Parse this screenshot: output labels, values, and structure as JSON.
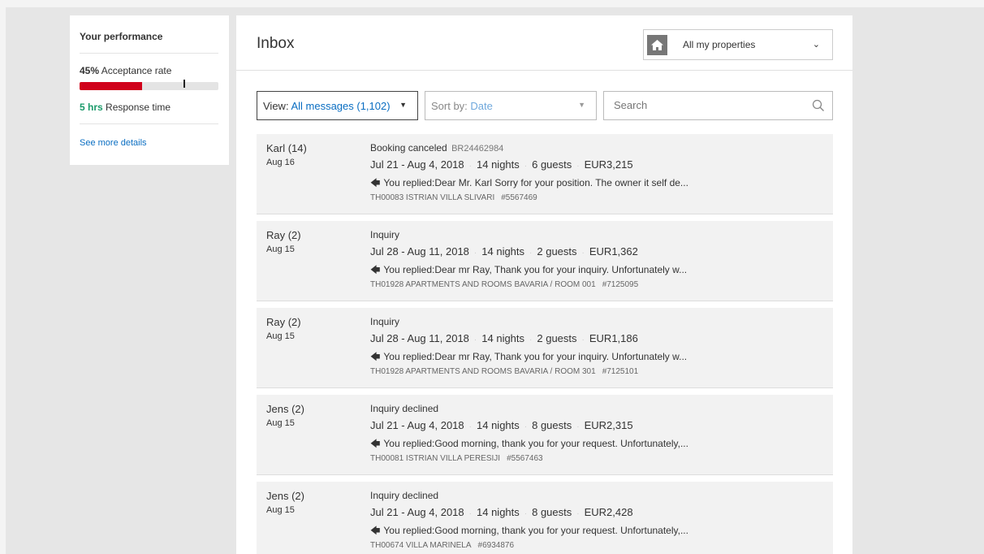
{
  "performance": {
    "title": "Your performance",
    "acceptance_value": "45%",
    "acceptance_label": "Acceptance rate",
    "acceptance_fraction": 0.45,
    "response_value": "5 hrs",
    "response_label": "Response time",
    "see_more": "See more details"
  },
  "inbox": {
    "title": "Inbox",
    "property_selector": "All my properties"
  },
  "filters": {
    "view_key": "View: ",
    "view_value": "All messages (1,102)",
    "sort_key": "Sort by: ",
    "sort_value": "Date",
    "search_placeholder": "Search"
  },
  "messages": [
    {
      "name": "Karl (14)",
      "date": "Aug 16",
      "status": "Booking canceled",
      "ref": "BR24462984",
      "dates": "Jul 21 - Aug 4, 2018",
      "nights": "14 nights",
      "guests": "6 guests",
      "price": "EUR3,215",
      "reply": "You replied:Dear Mr. Karl Sorry for your position. The owner it self de...",
      "property": "TH00083 ISTRIAN VILLA SLIVARI",
      "property_id": "#5567469"
    },
    {
      "name": "Ray (2)",
      "date": "Aug 15",
      "status": "Inquiry",
      "ref": "",
      "dates": "Jul 28 - Aug 11, 2018",
      "nights": "14 nights",
      "guests": "2 guests",
      "price": "EUR1,362",
      "reply": "You replied:Dear mr Ray, Thank you for your inquiry. Unfortunately w...",
      "property": "TH01928 APARTMENTS AND ROOMS BAVARIA / ROOM 001",
      "property_id": "#7125095"
    },
    {
      "name": "Ray (2)",
      "date": "Aug 15",
      "status": "Inquiry",
      "ref": "",
      "dates": "Jul 28 - Aug 11, 2018",
      "nights": "14 nights",
      "guests": "2 guests",
      "price": "EUR1,186",
      "reply": "You replied:Dear mr Ray, Thank you for your inquiry. Unfortunately w...",
      "property": "TH01928 APARTMENTS AND ROOMS BAVARIA / ROOM 301",
      "property_id": "#7125101"
    },
    {
      "name": "Jens (2)",
      "date": "Aug 15",
      "status": "Inquiry declined",
      "ref": "",
      "dates": "Jul 21 - Aug 4, 2018",
      "nights": "14 nights",
      "guests": "8 guests",
      "price": "EUR2,315",
      "reply": "You replied:Good morning, thank you for your request. Unfortunately,...",
      "property": "TH00081 ISTRIAN VILLA PERESIJI",
      "property_id": "#5567463"
    },
    {
      "name": "Jens (2)",
      "date": "Aug 15",
      "status": "Inquiry declined",
      "ref": "",
      "dates": "Jul 21 - Aug 4, 2018",
      "nights": "14 nights",
      "guests": "8 guests",
      "price": "EUR2,428",
      "reply": "You replied:Good morning, thank you for your request. Unfortunately,...",
      "property": "TH00674 VILLA MARINELA",
      "property_id": "#6934876"
    }
  ],
  "colors": {
    "accent": "#0a6ec2",
    "acceptance_bar": "#d0021b",
    "response": "#1a9a6a"
  }
}
